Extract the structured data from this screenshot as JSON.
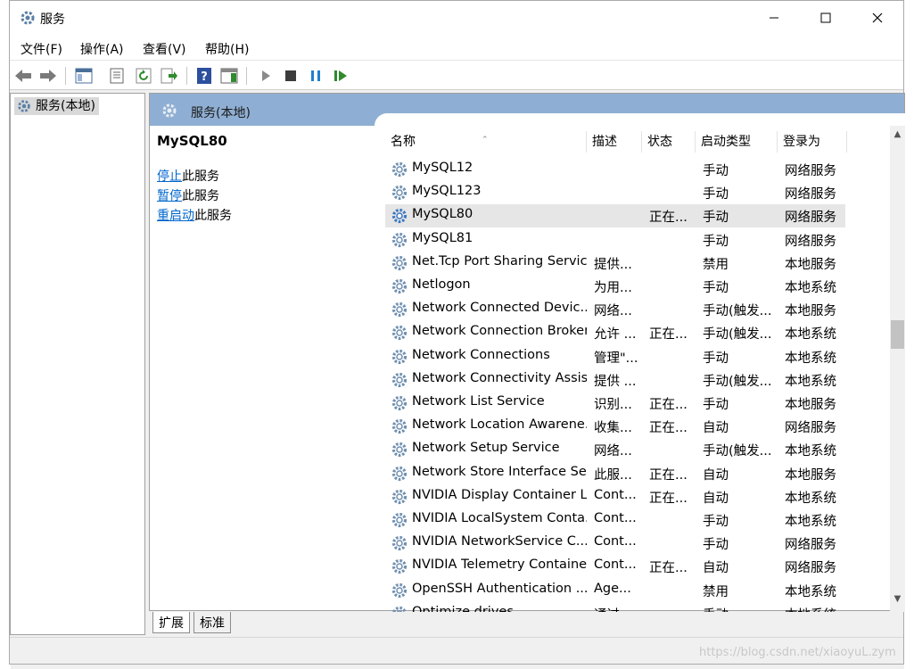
{
  "window": {
    "title": "服务",
    "minimize_icon": "minimize-icon",
    "maximize_icon": "maximize-icon",
    "close_icon": "close-icon"
  },
  "menu": [
    "文件(F)",
    "操作(A)",
    "查看(V)",
    "帮助(H)"
  ],
  "toolbar": {
    "icons": [
      "back-arrow-icon",
      "forward-arrow-icon",
      "show-hide-tree-icon",
      "properties-icon",
      "refresh-icon",
      "export-list-icon",
      "help-icon",
      "action-pane-icon",
      "start-service-icon",
      "stop-service-icon",
      "pause-service-icon",
      "restart-service-icon"
    ]
  },
  "tree": {
    "root_label": "服务(本地)"
  },
  "pane": {
    "header": "服务(本地)",
    "selected_service": "MySQL80",
    "actions": [
      {
        "link": "停止",
        "rest": "此服务"
      },
      {
        "link": "暂停",
        "rest": "此服务"
      },
      {
        "link": "重启动",
        "rest": "此服务"
      }
    ]
  },
  "columns": [
    "名称",
    "描述",
    "状态",
    "启动类型",
    "登录为"
  ],
  "services": [
    {
      "name": "MySQL12",
      "desc": "",
      "status": "",
      "startup": "手动",
      "logon": "网络服务"
    },
    {
      "name": "MySQL123",
      "desc": "",
      "status": "",
      "startup": "手动",
      "logon": "网络服务"
    },
    {
      "name": "MySQL80",
      "desc": "",
      "status": "正在...",
      "startup": "手动",
      "logon": "网络服务"
    },
    {
      "name": "MySQL81",
      "desc": "",
      "status": "",
      "startup": "手动",
      "logon": "网络服务"
    },
    {
      "name": "Net.Tcp Port Sharing Service",
      "desc": "提供...",
      "status": "",
      "startup": "禁用",
      "logon": "本地服务"
    },
    {
      "name": "Netlogon",
      "desc": "为用...",
      "status": "",
      "startup": "手动",
      "logon": "本地系统"
    },
    {
      "name": "Network Connected Devic...",
      "desc": "网络...",
      "status": "",
      "startup": "手动(触发...",
      "logon": "本地服务"
    },
    {
      "name": "Network Connection Broker",
      "desc": "允许 ...",
      "status": "正在...",
      "startup": "手动(触发...",
      "logon": "本地系统"
    },
    {
      "name": "Network Connections",
      "desc": "管理\"...",
      "status": "",
      "startup": "手动",
      "logon": "本地系统"
    },
    {
      "name": "Network Connectivity Assis...",
      "desc": "提供 ...",
      "status": "",
      "startup": "手动(触发...",
      "logon": "本地系统"
    },
    {
      "name": "Network List Service",
      "desc": "识别...",
      "status": "正在...",
      "startup": "手动",
      "logon": "本地服务"
    },
    {
      "name": "Network Location Awarene...",
      "desc": "收集...",
      "status": "正在...",
      "startup": "自动",
      "logon": "网络服务"
    },
    {
      "name": "Network Setup Service",
      "desc": "网络...",
      "status": "",
      "startup": "手动(触发...",
      "logon": "本地系统"
    },
    {
      "name": "Network Store Interface Se...",
      "desc": "此服...",
      "status": "正在...",
      "startup": "自动",
      "logon": "本地服务"
    },
    {
      "name": "NVIDIA Display Container LS",
      "desc": "Cont...",
      "status": "正在...",
      "startup": "自动",
      "logon": "本地系统"
    },
    {
      "name": "NVIDIA LocalSystem Conta...",
      "desc": "Cont...",
      "status": "",
      "startup": "手动",
      "logon": "本地系统"
    },
    {
      "name": "NVIDIA NetworkService C...",
      "desc": "Cont...",
      "status": "",
      "startup": "手动",
      "logon": "网络服务"
    },
    {
      "name": "NVIDIA Telemetry Container",
      "desc": "Cont...",
      "status": "正在...",
      "startup": "自动",
      "logon": "网络服务"
    },
    {
      "name": "OpenSSH Authentication ...",
      "desc": "Age...",
      "status": "",
      "startup": "禁用",
      "logon": "本地系统"
    },
    {
      "name": "Optimize drives",
      "desc": "通过 ...",
      "status": "",
      "startup": "手动",
      "logon": "本地系统"
    }
  ],
  "selected_index": 2,
  "bottom_tabs": [
    "扩展",
    "标准"
  ],
  "watermark": "https://blog.csdn.net/xiaoyuL.zym"
}
